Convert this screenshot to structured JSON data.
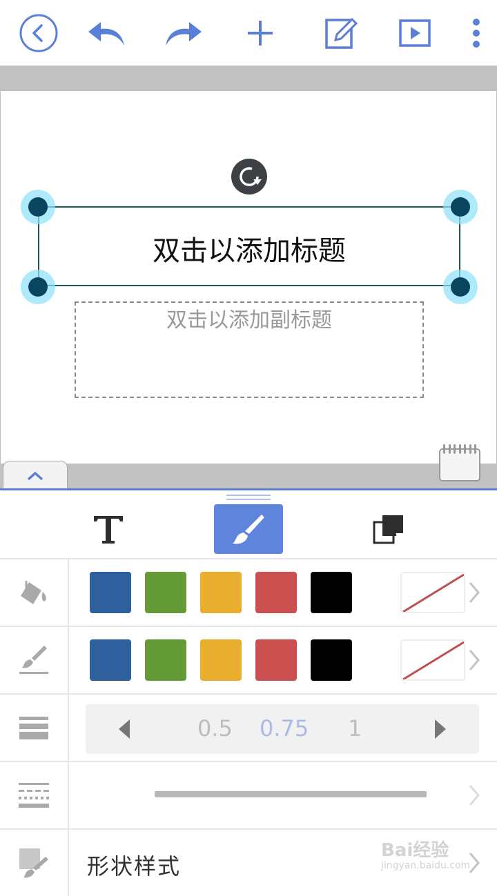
{
  "toolbar": {
    "back": "back-icon",
    "undo": "undo-icon",
    "redo": "redo-icon",
    "add": "plus-icon",
    "edit": "edit-icon",
    "play": "play-icon",
    "more": "more-vertical-icon",
    "accent": "#5a7fd6"
  },
  "slide": {
    "title_placeholder": "双击以添加标题",
    "subtitle_placeholder": "双击以添加副标题"
  },
  "panel": {
    "tabs": [
      "text-tab",
      "style-tab",
      "arrange-tab"
    ],
    "active_tab": "style-tab",
    "colors": [
      "#2f5f9c",
      "#659b37",
      "#eaae2e",
      "#c9504f",
      "#000000"
    ],
    "line_widths": [
      "0.5",
      "0.75",
      "1"
    ],
    "selected_width": "0.75",
    "shape_style_label": "形状样式"
  },
  "watermark": {
    "brand": "Bai经验",
    "url": "jingyan.baidu.com"
  }
}
